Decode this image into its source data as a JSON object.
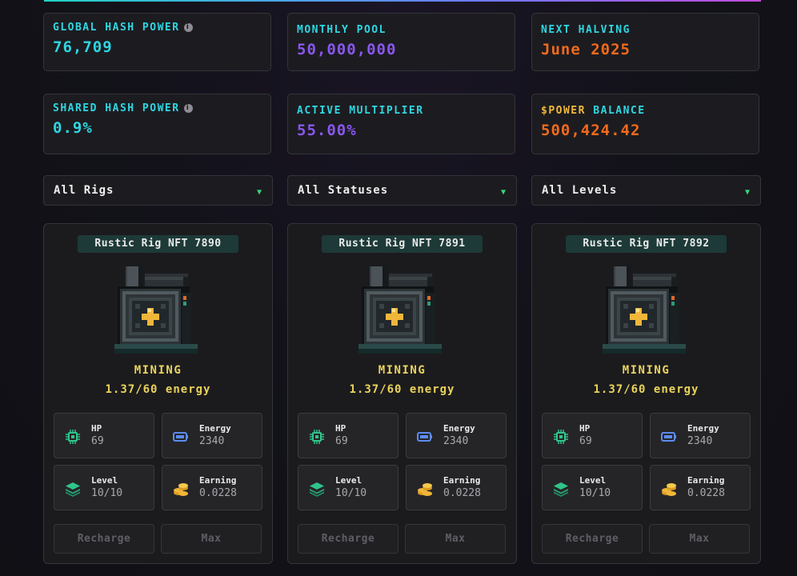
{
  "stats": [
    {
      "label": "GLOBAL HASH POWER",
      "value": "76,709",
      "info": true,
      "color": "#2fd6e2"
    },
    {
      "label": "MONTHLY POOL",
      "value": "50,000,000",
      "info": false,
      "color": "#8a57f0"
    },
    {
      "label": "NEXT HALVING",
      "value": "June 2025",
      "info": false,
      "color": "#f26a1c"
    },
    {
      "label": "SHARED HASH POWER",
      "value": "0.9%",
      "info": true,
      "color": "#2fd6e2"
    },
    {
      "label": "ACTIVE MULTIPLIER",
      "value": "55.00%",
      "info": false,
      "color": "#8a57f0"
    },
    {
      "label_prefix": "$POWER",
      "label_suffix": " BALANCE",
      "value": "500,424.42",
      "info": false,
      "color": "#f26a1c"
    }
  ],
  "info_glyph": "i",
  "filters": [
    {
      "label": "All Rigs"
    },
    {
      "label": "All Statuses"
    },
    {
      "label": "All Levels"
    }
  ],
  "caret_glyph": "▼",
  "cards": [
    {
      "title": "Rustic Rig NFT 7890",
      "status": "MINING",
      "energy_text": "1.37/60 energy",
      "stats": {
        "hp_label": "HP",
        "hp": "69",
        "energy_label": "Energy",
        "energy": "2340",
        "level_label": "Level",
        "level": "10/10",
        "earning_label": "Earning",
        "earning": "0.0228"
      },
      "recharge_label": "Recharge",
      "max_label": "Max"
    },
    {
      "title": "Rustic Rig NFT 7891",
      "status": "MINING",
      "energy_text": "1.37/60 energy",
      "stats": {
        "hp_label": "HP",
        "hp": "69",
        "energy_label": "Energy",
        "energy": "2340",
        "level_label": "Level",
        "level": "10/10",
        "earning_label": "Earning",
        "earning": "0.0228"
      },
      "recharge_label": "Recharge",
      "max_label": "Max"
    },
    {
      "title": "Rustic Rig NFT 7892",
      "status": "MINING",
      "energy_text": "1.37/60 energy",
      "stats": {
        "hp_label": "HP",
        "hp": "69",
        "energy_label": "Energy",
        "energy": "2340",
        "level_label": "Level",
        "level": "10/10",
        "earning_label": "Earning",
        "earning": "0.0228"
      },
      "recharge_label": "Recharge",
      "max_label": "Max"
    }
  ],
  "icons": {
    "hp": "chip-icon",
    "energy": "battery-icon",
    "level": "layers-icon",
    "earning": "coins-icon",
    "rig": "mining-rig-icon"
  }
}
